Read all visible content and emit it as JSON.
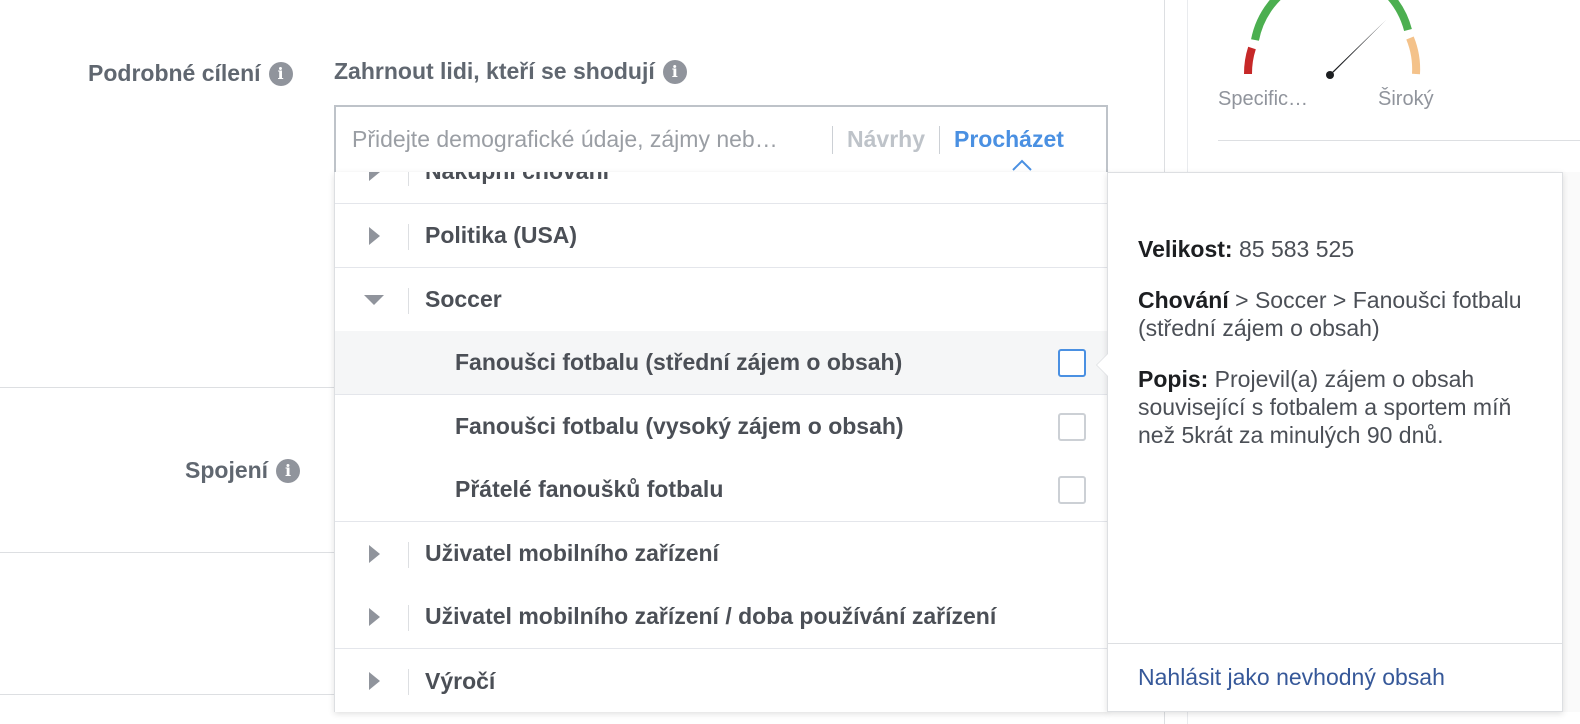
{
  "targeting": {
    "detailed_label": "Podrobné cílení",
    "include_label": "Zahrnout lidi, kteří se shodují",
    "connections_label": "Spojení"
  },
  "search": {
    "placeholder": "Přidejte demografické údaje, zájmy neb…",
    "suggestions_label": "Návrhy",
    "browse_label": "Procházet"
  },
  "dropdown": {
    "partial_top": "Nákupní chování",
    "categories": [
      {
        "label": "Politika (USA)"
      },
      {
        "label": "Soccer",
        "expanded": true
      }
    ],
    "subitems": [
      {
        "label": "Fanoušci fotbalu (střední zájem o obsah)",
        "checked": false,
        "highlighted": true
      },
      {
        "label": "Fanoušci fotbalu (vysoký zájem o obsah)",
        "checked": false
      },
      {
        "label": "Přátelé fanoušků fotbalu",
        "checked": false
      }
    ],
    "more_categories": [
      {
        "label": "Uživatel mobilního zařízení"
      },
      {
        "label": "Uživatel mobilního zařízení / doba používání zařízení"
      },
      {
        "label": "Výročí"
      }
    ]
  },
  "info_panel": {
    "size_label": "Velikost:",
    "size_value": "85 583 525",
    "path_label": "Chování",
    "path_value": "> Soccer > Fanoušci fotbalu (střední zájem o obsah)",
    "desc_label": "Popis:",
    "desc_value": "Projevil(a) zájem o obsah související s fotbalem a sportem míň než 5krát za minulých 90 dnů.",
    "report_link": "Nahlásit jako nevhodný obsah"
  },
  "audience_gauge": {
    "specific_label": "Specific…",
    "broad_label": "Široký",
    "colors": {
      "red": "#c62828",
      "green": "#4caf50",
      "orange": "#f4c28a",
      "needle": "#1c1e21"
    }
  },
  "colors": {
    "accent": "#4a90e2",
    "link": "#365899",
    "text": "#4b4f56",
    "muted": "#90949c"
  }
}
